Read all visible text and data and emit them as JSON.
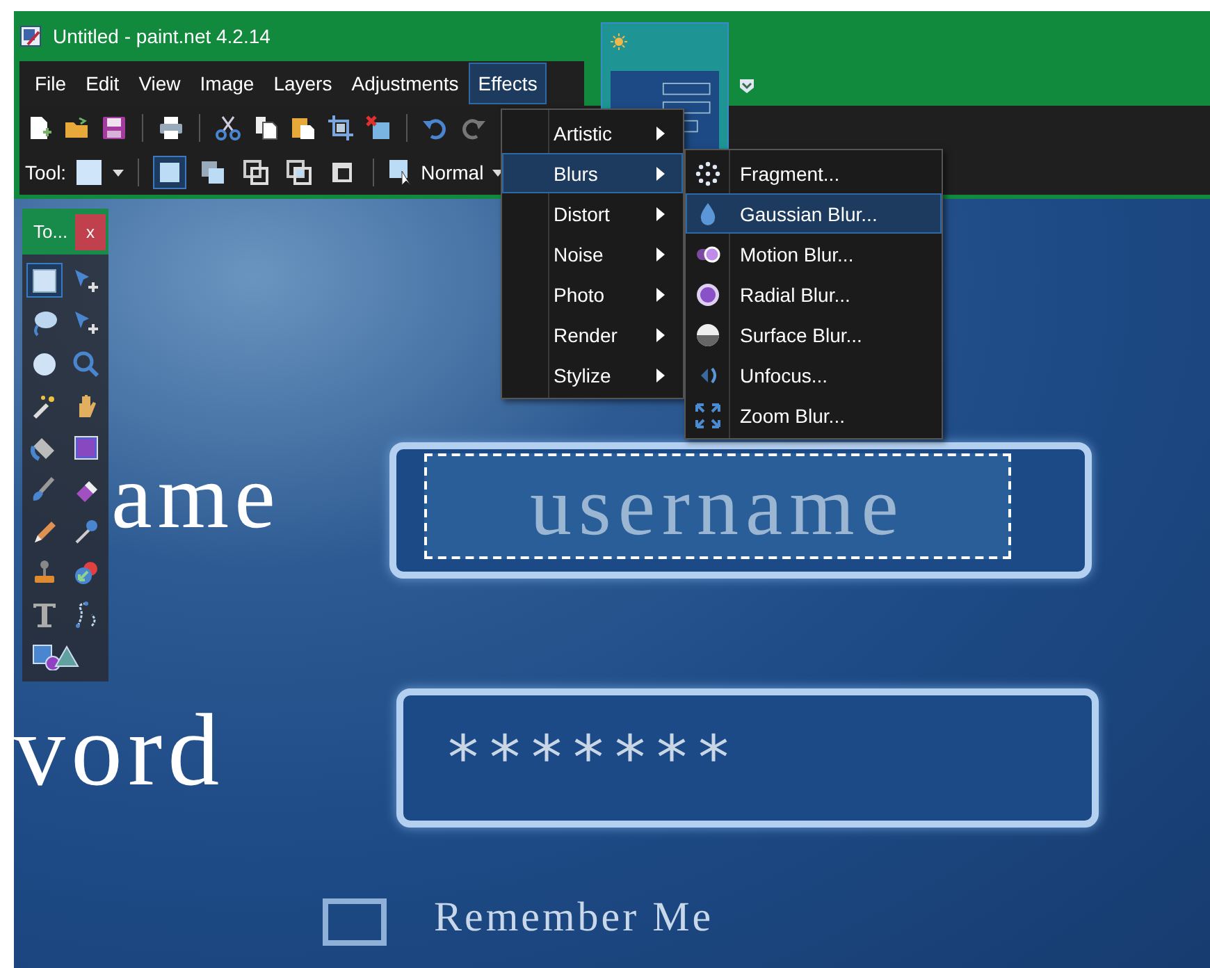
{
  "window": {
    "title": "Untitled - paint.net 4.2.14"
  },
  "menu_bar": [
    {
      "label": "File",
      "selected": false
    },
    {
      "label": "Edit",
      "selected": false
    },
    {
      "label": "View",
      "selected": false
    },
    {
      "label": "Image",
      "selected": false
    },
    {
      "label": "Layers",
      "selected": false
    },
    {
      "label": "Adjustments",
      "selected": false
    },
    {
      "label": "Effects",
      "selected": true
    }
  ],
  "toolbar": {
    "tool_label": "Tool:",
    "selection_modes": [
      {
        "selected": true
      },
      {
        "selected": false
      },
      {
        "selected": false
      },
      {
        "selected": false
      },
      {
        "selected": false
      }
    ],
    "blend_mode": "Normal"
  },
  "tools_window": {
    "title": "To...",
    "close": "x",
    "tools": [
      {
        "kind": "rect-select",
        "selected": true
      },
      {
        "kind": "move",
        "selected": false
      },
      {
        "kind": "lasso",
        "selected": false
      },
      {
        "kind": "move",
        "selected": false
      },
      {
        "kind": "ellipse",
        "selected": false
      },
      {
        "kind": "zoom",
        "selected": false
      },
      {
        "kind": "wand",
        "selected": false
      },
      {
        "kind": "hand",
        "selected": false
      },
      {
        "kind": "bucket",
        "selected": false
      },
      {
        "kind": "gradient",
        "selected": false
      },
      {
        "kind": "brush",
        "selected": false
      },
      {
        "kind": "eraser",
        "selected": false
      },
      {
        "kind": "pencil",
        "selected": false
      },
      {
        "kind": "picker",
        "selected": false
      },
      {
        "kind": "stamp",
        "selected": false
      },
      {
        "kind": "recolor",
        "selected": false
      },
      {
        "kind": "text",
        "selected": false
      },
      {
        "kind": "line",
        "selected": false
      },
      {
        "kind": "shapes",
        "selected": false
      }
    ]
  },
  "effects_menu": [
    {
      "label": "Artistic",
      "selected": false
    },
    {
      "label": "Blurs",
      "selected": true
    },
    {
      "label": "Distort",
      "selected": false
    },
    {
      "label": "Noise",
      "selected": false
    },
    {
      "label": "Photo",
      "selected": false
    },
    {
      "label": "Render",
      "selected": false
    },
    {
      "label": "Stylize",
      "selected": false
    }
  ],
  "blurs_submenu": [
    {
      "label": "Fragment...",
      "kind": "fragment",
      "selected": false
    },
    {
      "label": "Gaussian Blur...",
      "kind": "gaussian",
      "selected": true
    },
    {
      "label": "Motion Blur...",
      "kind": "motion",
      "selected": false
    },
    {
      "label": "Radial Blur...",
      "kind": "radial",
      "selected": false
    },
    {
      "label": "Surface Blur...",
      "kind": "surface",
      "selected": false
    },
    {
      "label": "Unfocus...",
      "kind": "unfocus",
      "selected": false
    },
    {
      "label": "Zoom Blur...",
      "kind": "zoom",
      "selected": false
    }
  ],
  "canvas": {
    "username_label": "ame",
    "username_field": {
      "value": "username",
      "selected": true
    },
    "password_label": "vord",
    "password_field": {
      "value": "*******"
    },
    "remember": {
      "label": "Remember Me",
      "checked": false
    }
  }
}
